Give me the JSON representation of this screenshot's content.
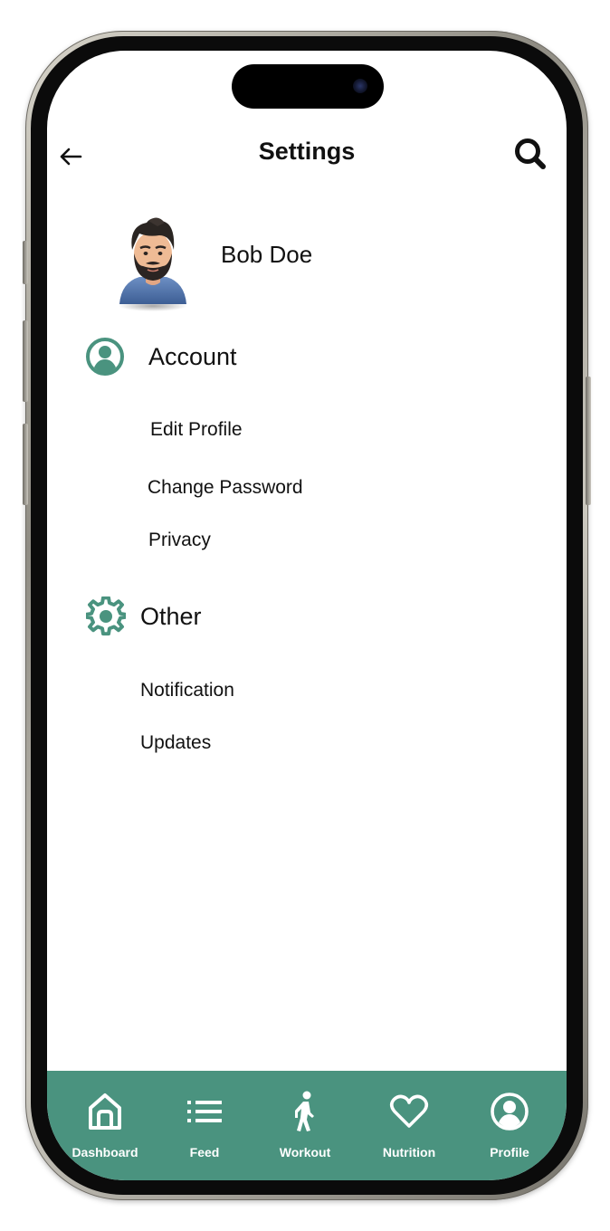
{
  "header": {
    "title": "Settings"
  },
  "profile": {
    "name": "Bob Doe"
  },
  "sections": [
    {
      "label": "Account",
      "items": [
        "Edit Profile",
        "Change Password",
        "Privacy"
      ]
    },
    {
      "label": "Other",
      "items": [
        "Notification",
        "Updates"
      ]
    }
  ],
  "nav": {
    "items": [
      {
        "label": "Dashboard",
        "icon": "home-icon"
      },
      {
        "label": "Feed",
        "icon": "list-icon"
      },
      {
        "label": "Workout",
        "icon": "walking-person-icon"
      },
      {
        "label": "Nutrition",
        "icon": "heart-icon"
      },
      {
        "label": "Profile",
        "icon": "user-circle-icon"
      }
    ]
  },
  "colors": {
    "accent": "#4a937f",
    "text": "#111111",
    "background": "#ffffff"
  }
}
